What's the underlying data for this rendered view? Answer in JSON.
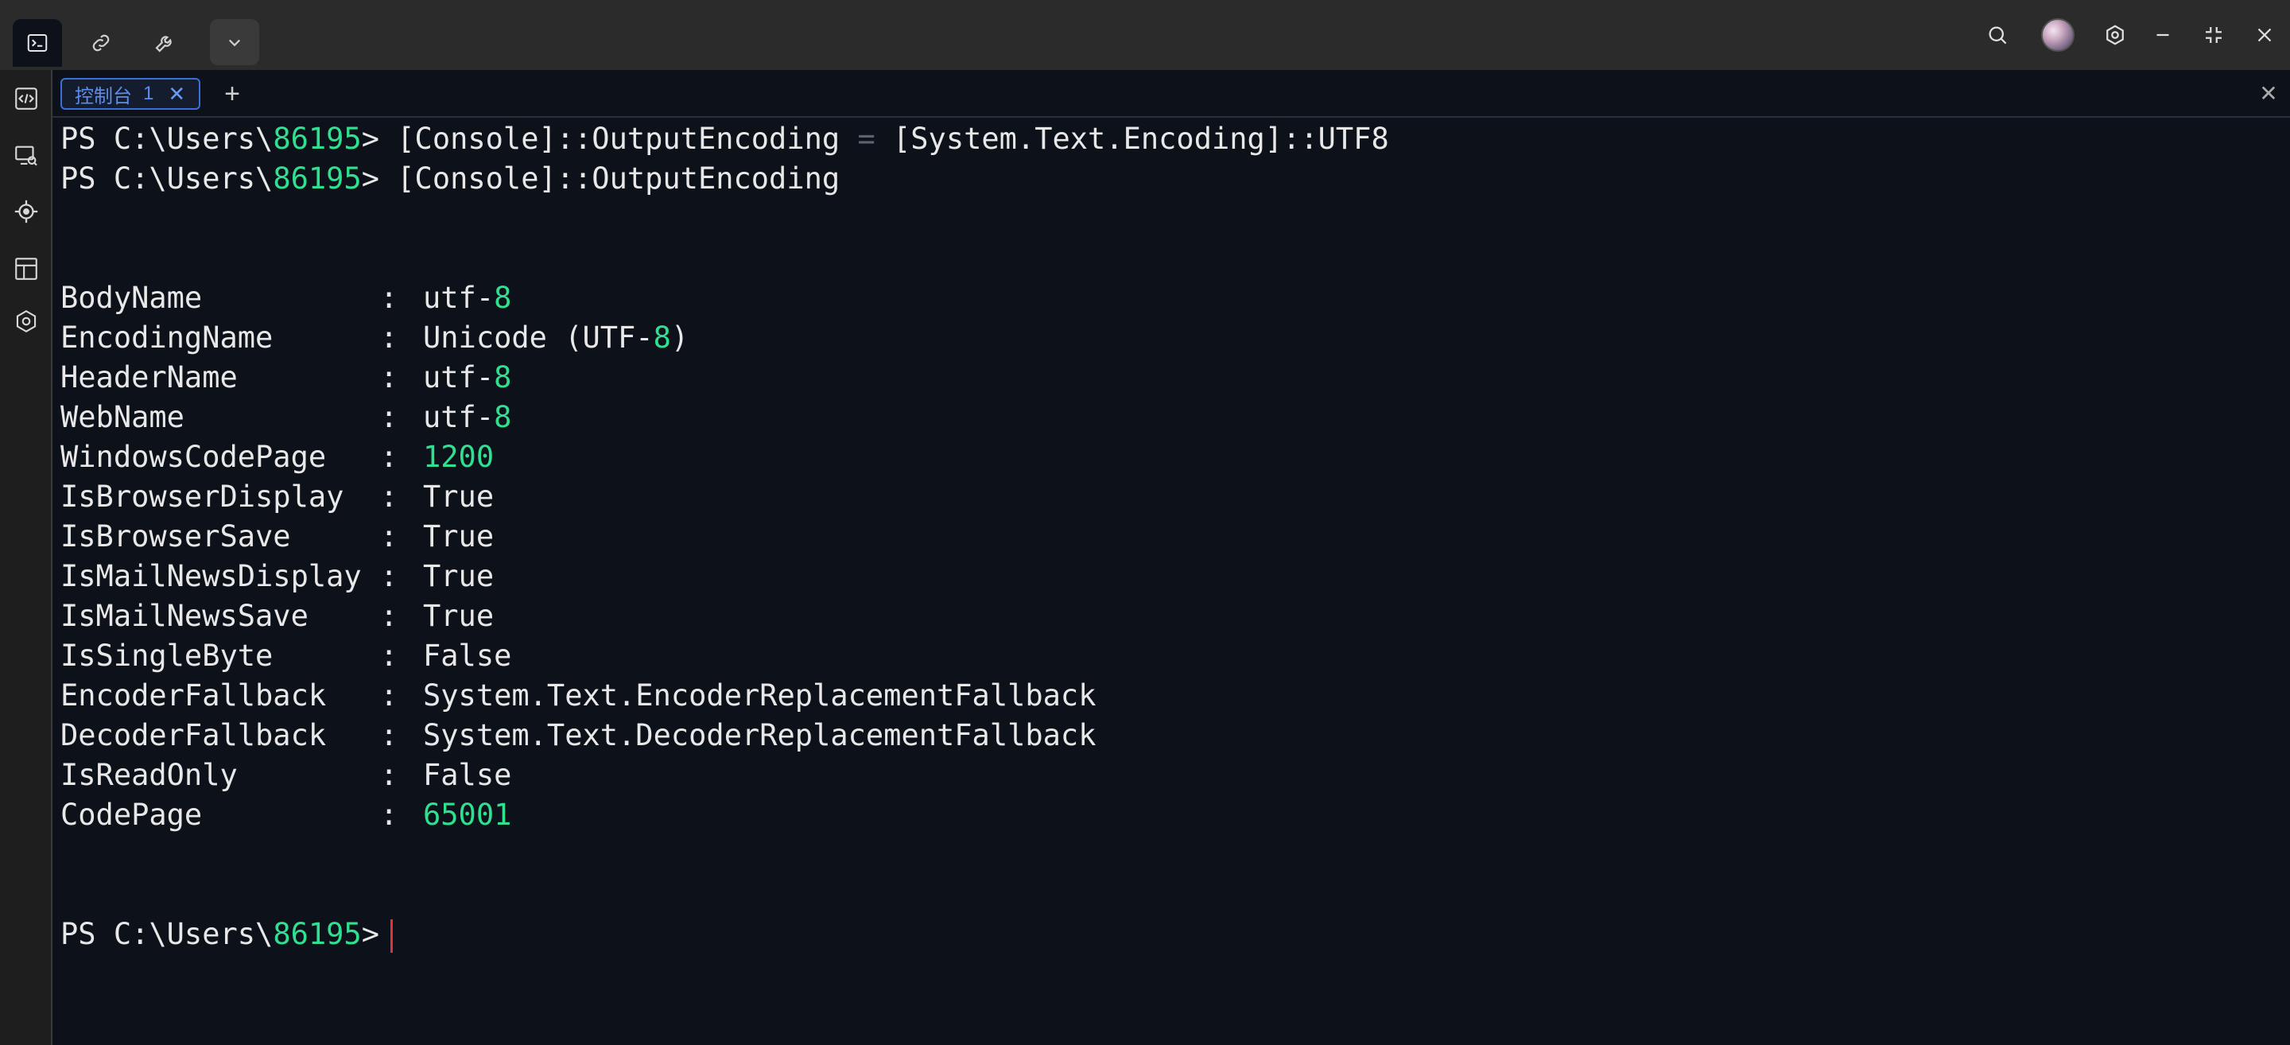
{
  "titlebar": {
    "icons": [
      "terminal-icon",
      "link-icon",
      "wrench-icon",
      "chevron-down-icon"
    ],
    "right_icons": [
      "search-icon",
      "avatar",
      "settings-icon",
      "minimize-icon",
      "restore-icon",
      "close-icon"
    ]
  },
  "sidebar": {
    "icons": [
      "code-panel-icon",
      "remote-screen-icon",
      "target-icon",
      "layout-icon",
      "hexagon-settings-icon"
    ]
  },
  "tab": {
    "label": "控制台",
    "number": "1",
    "close": "✕",
    "add": "+"
  },
  "terminal": {
    "cmd1": {
      "prompt_prefix": "PS C:\\Users\\",
      "prompt_user": "86195",
      "prompt_suffix": "> ",
      "command_a": "[Console]::OutputEncoding ",
      "command_op": "=",
      "command_b": " [System.Text.Encoding]::UTF8"
    },
    "cmd2": {
      "prompt_prefix": "PS C:\\Users\\",
      "prompt_user": "86195",
      "prompt_suffix": "> ",
      "command": "[Console]::OutputEncoding"
    },
    "properties": [
      {
        "name": "BodyName",
        "value_a": "utf-",
        "value_num": "8",
        "value_b": ""
      },
      {
        "name": "EncodingName",
        "value_a": "Unicode (UTF-",
        "value_num": "8",
        "value_b": ")"
      },
      {
        "name": "HeaderName",
        "value_a": "utf-",
        "value_num": "8",
        "value_b": ""
      },
      {
        "name": "WebName",
        "value_a": "utf-",
        "value_num": "8",
        "value_b": ""
      },
      {
        "name": "WindowsCodePage",
        "value_a": "",
        "value_num": "1200",
        "value_b": ""
      },
      {
        "name": "IsBrowserDisplay",
        "value_a": "True",
        "value_num": "",
        "value_b": ""
      },
      {
        "name": "IsBrowserSave",
        "value_a": "True",
        "value_num": "",
        "value_b": ""
      },
      {
        "name": "IsMailNewsDisplay",
        "value_a": "True",
        "value_num": "",
        "value_b": ""
      },
      {
        "name": "IsMailNewsSave",
        "value_a": "True",
        "value_num": "",
        "value_b": ""
      },
      {
        "name": "IsSingleByte",
        "value_a": "False",
        "value_num": "",
        "value_b": ""
      },
      {
        "name": "EncoderFallback",
        "value_a": "System.Text.EncoderReplacementFallback",
        "value_num": "",
        "value_b": ""
      },
      {
        "name": "DecoderFallback",
        "value_a": "System.Text.DecoderReplacementFallback",
        "value_num": "",
        "value_b": ""
      },
      {
        "name": "IsReadOnly",
        "value_a": "False",
        "value_num": "",
        "value_b": ""
      },
      {
        "name": "CodePage",
        "value_a": "",
        "value_num": "65001",
        "value_b": ""
      }
    ],
    "colon": ":",
    "prompt_final": {
      "prompt_prefix": "PS C:\\Users\\",
      "prompt_user": "86195",
      "prompt_suffix": ">"
    }
  },
  "colors": {
    "background": "#0d111a",
    "accent_green": "#2ee08f",
    "tab_accent": "#3b6fd8",
    "cursor": "#e0303a"
  }
}
